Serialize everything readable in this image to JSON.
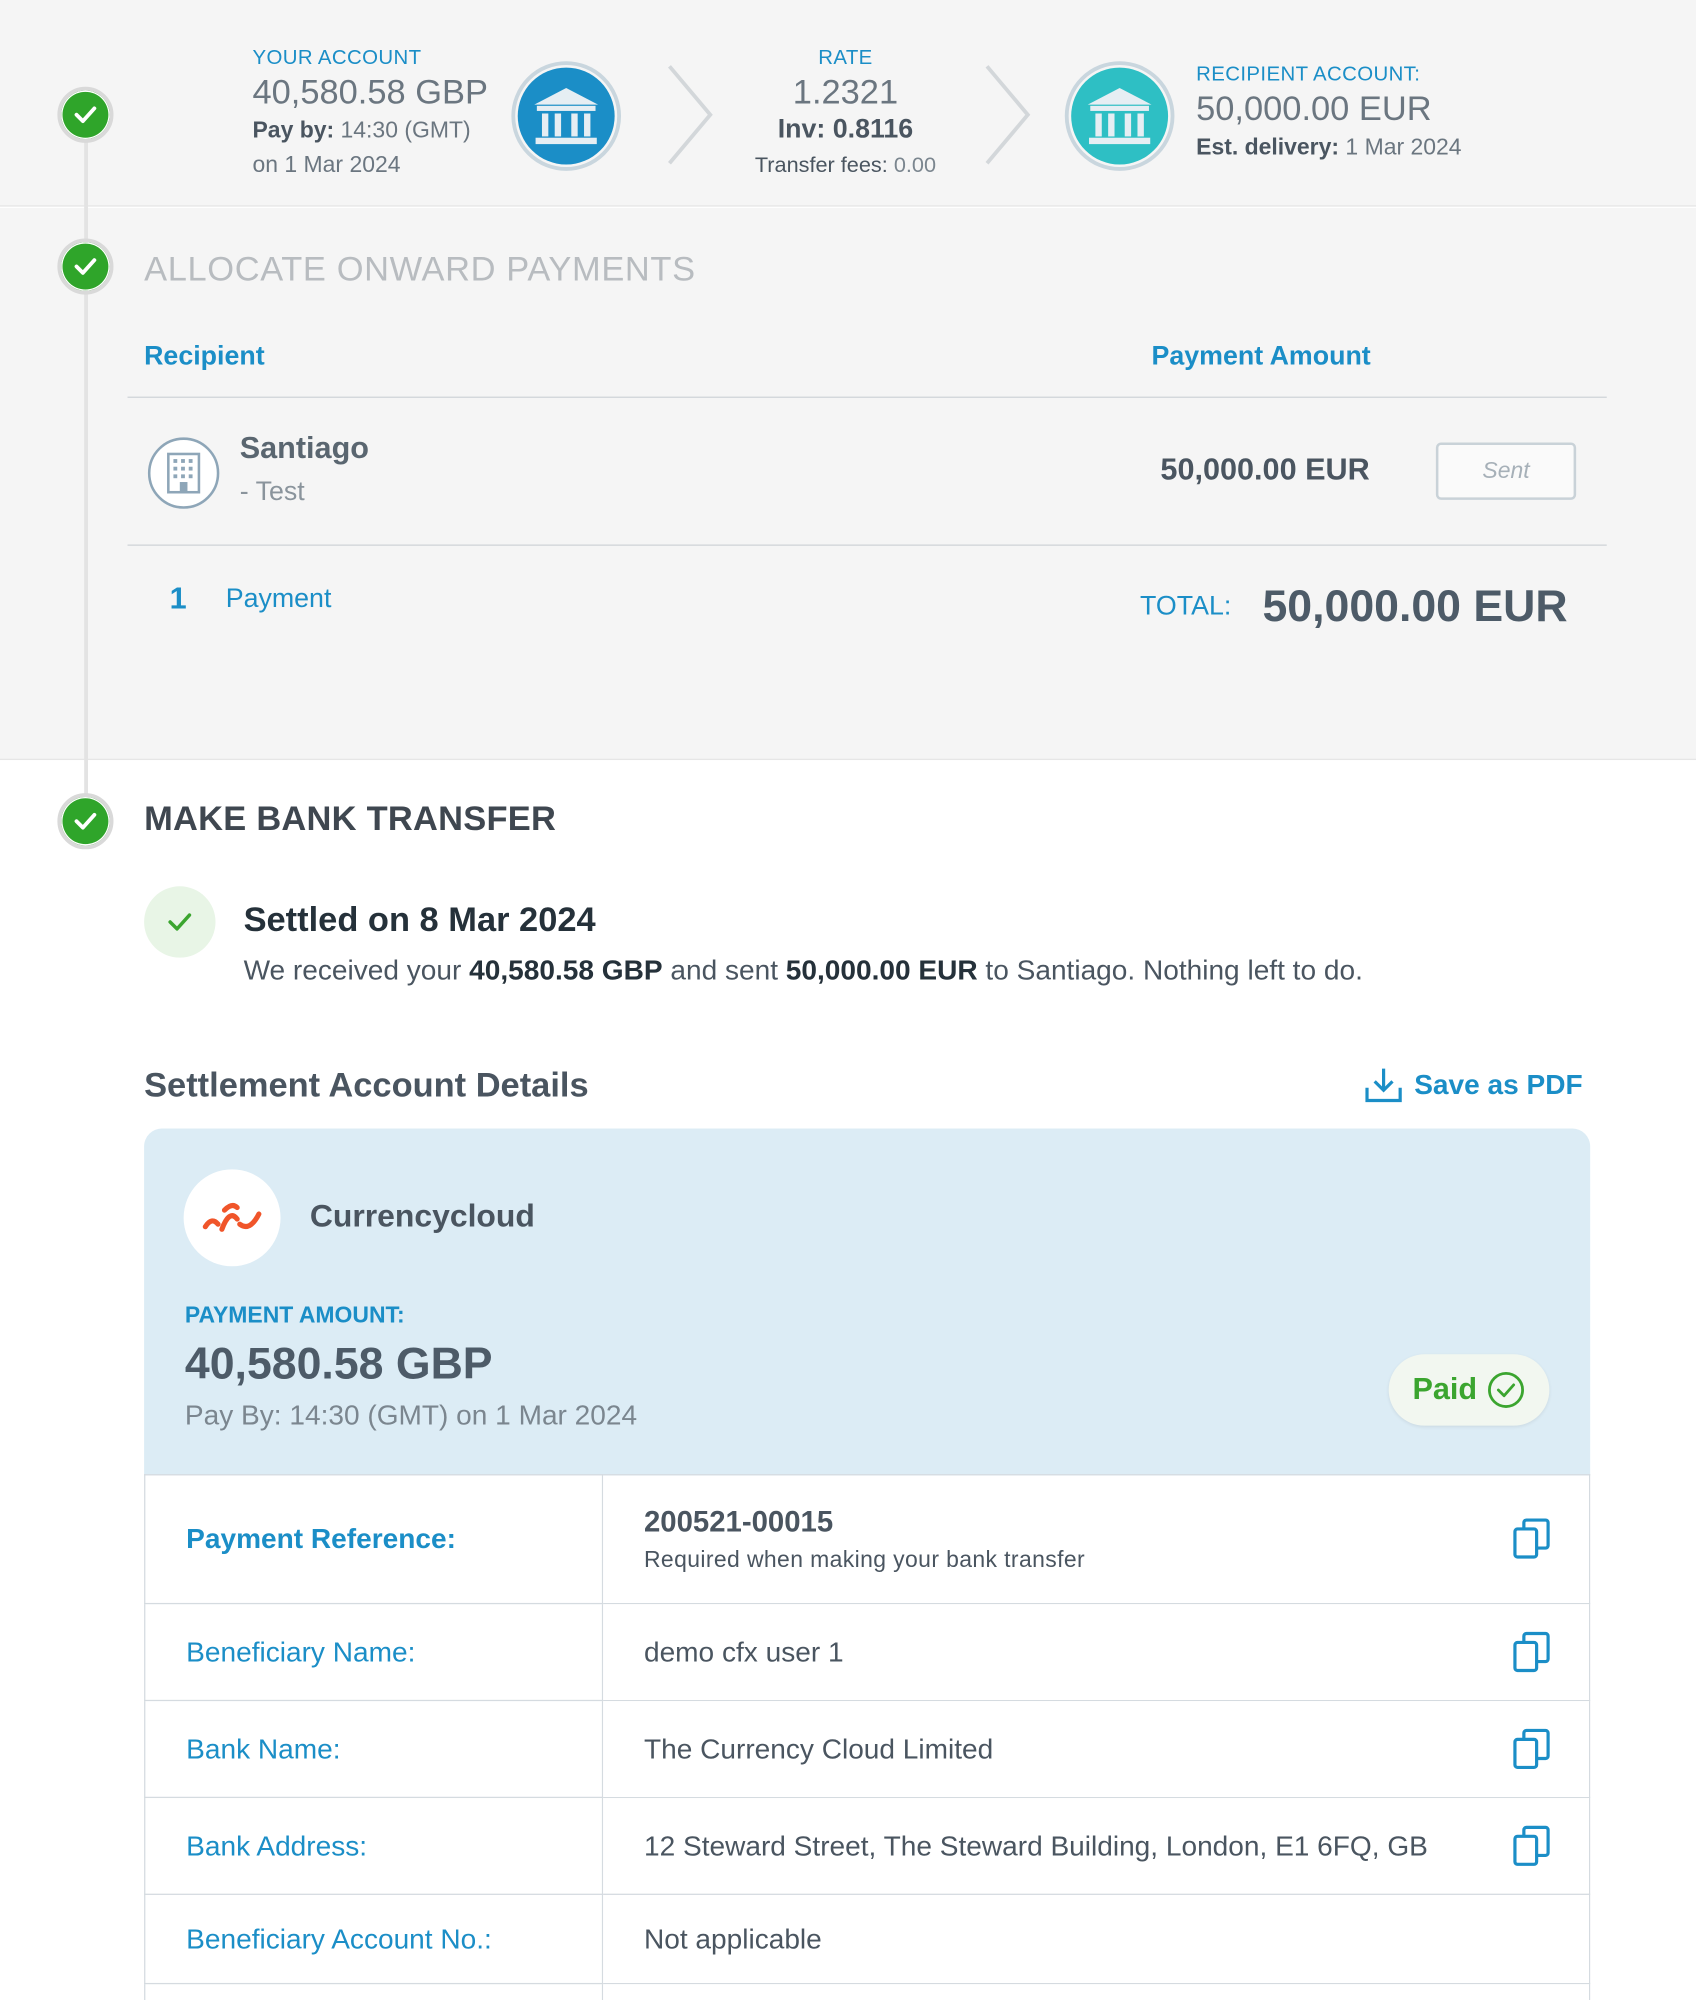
{
  "summary": {
    "your_account_label": "YOUR ACCOUNT",
    "your_amount": "40,580.58 GBP",
    "pay_by_label": "Pay by:",
    "pay_by_time": " 14:30 (GMT)",
    "pay_by_date": "on 1 Mar 2024",
    "rate_label": "RATE",
    "rate_value": "1.2321",
    "inv_label": "Inv:",
    "inv_value": "0.8116",
    "fees_label": "Transfer fees:",
    "fees_value": "0.00",
    "recipient_label": "RECIPIENT ACCOUNT:",
    "recipient_amount": "50,000.00 EUR",
    "delivery_label": "Est. delivery:",
    "delivery_date": "1 Mar 2024"
  },
  "allocate": {
    "title": "ALLOCATE ONWARD PAYMENTS",
    "col_recipient": "Recipient",
    "col_amount": "Payment Amount",
    "rows": [
      {
        "name": "Santiago",
        "sub": "- Test",
        "amount": "50,000.00 EUR",
        "status": "Sent"
      }
    ],
    "count": "1",
    "count_label": "Payment",
    "total_label": "TOTAL:",
    "total_value": "50,000.00 EUR"
  },
  "transfer": {
    "title": "MAKE BANK TRANSFER",
    "settled_title": "Settled on 8 Mar 2024",
    "settled_pre": "We received your ",
    "settled_gbp": "40,580.58 GBP",
    "settled_mid": " and sent ",
    "settled_eur": "50,000.00 EUR",
    "settled_post": " to Santiago. Nothing left to do.",
    "details_title": "Settlement Account Details",
    "save_pdf": "Save as PDF",
    "provider": "Currencycloud",
    "payment_amount_label": "PAYMENT AMOUNT:",
    "payment_amount": "40,580.58 GBP",
    "pay_by_line": "Pay By: 14:30 (GMT) on 1 Mar 2024",
    "paid_label": "Paid",
    "details": [
      {
        "key": "Payment Reference:",
        "value": "200521-00015",
        "note": "Required when making your bank transfer",
        "copy": true
      },
      {
        "key": "Beneficiary Name:",
        "value": "demo cfx user 1",
        "copy": true
      },
      {
        "key": "Bank Name:",
        "value": "The Currency Cloud Limited",
        "copy": true
      },
      {
        "key": "Bank Address:",
        "value": "12 Steward Street, The Steward Building, London, E1 6FQ, GB",
        "copy": true
      },
      {
        "key": "Beneficiary Account No.:",
        "value": "Not applicable",
        "copy": false
      }
    ]
  },
  "colors": {
    "accent": "#1b8ec7",
    "success": "#2fa52a",
    "panel": "#f5f5f5",
    "card": "#dcecf5"
  }
}
